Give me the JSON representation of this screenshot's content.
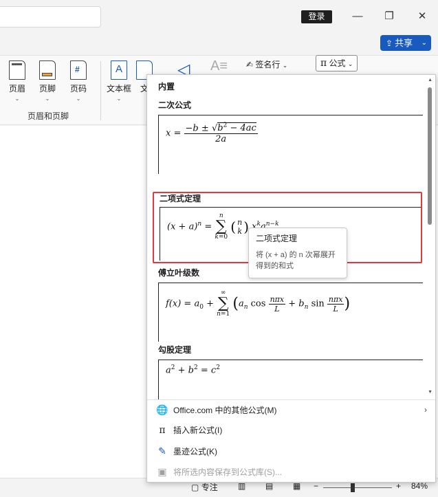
{
  "titlebar": {
    "login_label": "登录",
    "minimize_glyph": "—",
    "restore_glyph": "❐",
    "close_glyph": "✕",
    "share_label": "共享"
  },
  "ribbon": {
    "header": "页眉",
    "footer": "页脚",
    "page_number": "页码",
    "group_label": "页眉和页脚",
    "textbox": "文本框",
    "docpart_partial": "文",
    "signature_line": "签名行",
    "equation": "公式",
    "equation_glyph": "π"
  },
  "panel": {
    "section_title": "内置",
    "equations": [
      {
        "title": "二次公式"
      },
      {
        "title": "二项式定理"
      },
      {
        "title": "傅立叶级数"
      },
      {
        "title": "勾股定理"
      }
    ],
    "tooltip": {
      "title": "二项式定理",
      "description": "将 (x + a) 的 n 次幂展开得到的和式"
    },
    "menu": [
      {
        "label": "Office.com 中的其他公式(M)",
        "icon": "globe-icon",
        "glyph": "🌐",
        "has_submenu": true,
        "enabled": true
      },
      {
        "label": "插入新公式(I)",
        "icon": "pi-icon",
        "glyph": "π",
        "enabled": true
      },
      {
        "label": "墨迹公式(K)",
        "icon": "ink-equation-icon",
        "glyph": "✎",
        "enabled": true
      },
      {
        "label": "将所选内容保存到公式库(S)...",
        "icon": "save-icon",
        "glyph": "▣",
        "enabled": false
      }
    ]
  },
  "statusbar": {
    "focus_label": "专注",
    "zoom": "84%",
    "zoom_out": "−",
    "zoom_in": "+"
  },
  "colors": {
    "accent": "#185abd",
    "highlight_border": "#e3393c"
  }
}
